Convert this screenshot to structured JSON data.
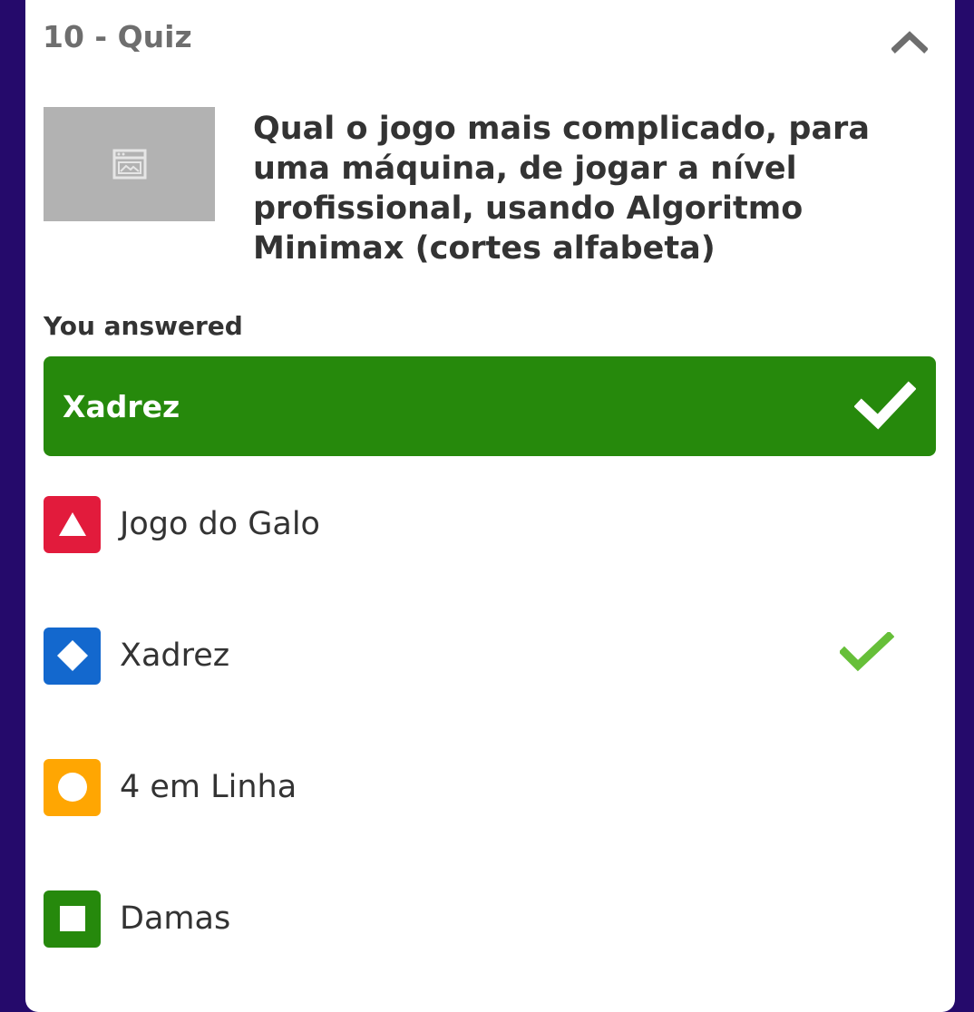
{
  "quiz": {
    "title": "10 - Quiz",
    "question": "Qual o jogo mais complicado, para uma máquina, de jogar a nível profissional, usando Algoritmo Minimax (cortes alfabeta)",
    "image_placeholder_icon": "image-icon",
    "collapse_icon": "chevron-up-icon"
  },
  "answer": {
    "label": "You answered",
    "value": "Xadrez",
    "status": "correct",
    "icon": "checkmark-icon"
  },
  "options": [
    {
      "label": "Jogo do Galo",
      "shape": "triangle-icon",
      "color": "#e21b3c",
      "correct": false
    },
    {
      "label": "Xadrez",
      "shape": "diamond-icon",
      "color": "#1368ce",
      "correct": true
    },
    {
      "label": "4 em Linha",
      "shape": "circle-icon",
      "color": "#ffa602",
      "correct": false
    },
    {
      "label": "Damas",
      "shape": "square-icon",
      "color": "#26890c",
      "correct": false
    }
  ],
  "colors": {
    "background": "#250a6b",
    "correct_answer": "#26890c",
    "correct_check": "#66bf39"
  }
}
